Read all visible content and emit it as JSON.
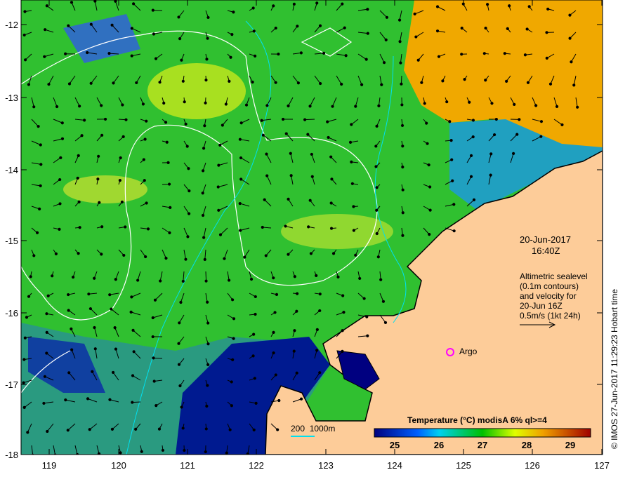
{
  "map": {
    "date": "20-Jun-2017",
    "time": "16:40Z",
    "legend_lines": [
      "Altimetric sealevel",
      "(0.1m contours)",
      "and velocity for",
      "20-Jun 16Z",
      "0.5m/s (1kt 24h)"
    ],
    "argo_label": "Argo",
    "depth_label": "200  1000m",
    "credit": "© IMOS 27-Jun-2017 11:29:23 Hobart time",
    "x_ticks": [
      "119",
      "120",
      "121",
      "122",
      "123",
      "124",
      "125",
      "126",
      "127"
    ],
    "y_ticks": [
      "-12",
      "-13",
      "-14",
      "-15",
      "-16",
      "-17",
      "-18"
    ],
    "colorbar": {
      "title": "Temperature (°C) modisA 6% ql>=4",
      "ticks": [
        "25",
        "26",
        "27",
        "28",
        "29"
      ],
      "range": [
        24.5,
        29.5
      ]
    },
    "colors": {
      "land": "#fdcc99",
      "ocean_mid": "#22c030",
      "warm": "#f0a000",
      "cool": "#0040c0",
      "contour": "#ffffff",
      "isobath": "#00e0f0",
      "argo": "#ff00ff"
    }
  }
}
